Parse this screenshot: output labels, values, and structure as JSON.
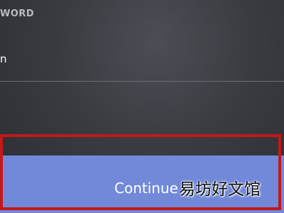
{
  "form": {
    "field_label": "WORD",
    "field_value_fragment": "n"
  },
  "continue_button": {
    "label": "Continue",
    "background_color": "#7289da"
  },
  "highlight": {
    "border_color": "#c41818"
  },
  "watermark": {
    "text": "易坊好文馆"
  }
}
